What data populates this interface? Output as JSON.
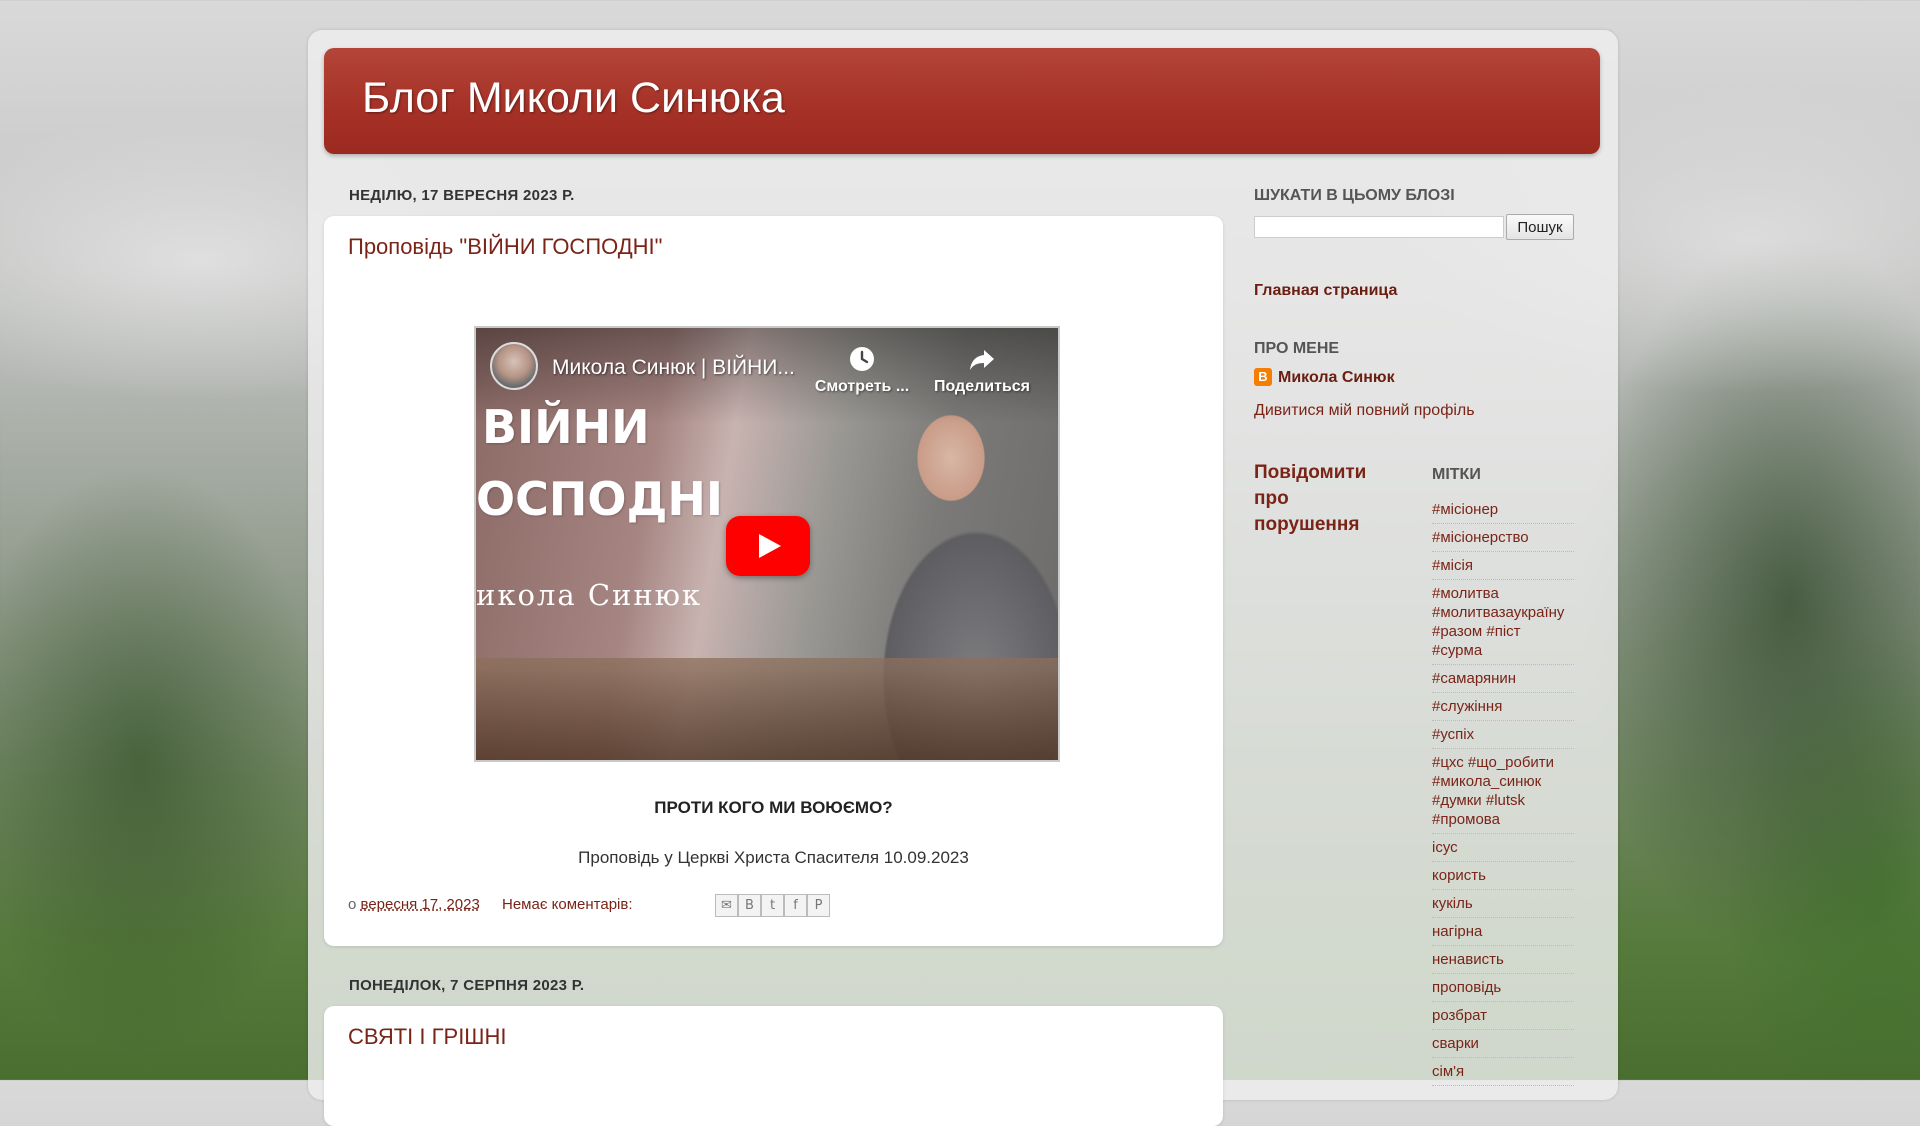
{
  "blog": {
    "title": "Блог Миколи Синюка"
  },
  "posts": [
    {
      "date_header": "НЕДІЛЮ, 17 ВЕРЕСНЯ 2023 Р.",
      "title": "Проповідь \"ВІЙНИ ГОСПОДНІ\"",
      "video": {
        "title": "Микола Синюк | ВІЙНИ...",
        "watch_later": "Смотреть ...",
        "share": "Поделиться",
        "overlay_line1": "ВІЙНИ",
        "overlay_line2": "ОСПОДНІ",
        "overlay_name": "икола Синюк"
      },
      "subtitle": "ПРОТИ КОГО МИ ВОЮЄМО?",
      "body": "Проповідь у Церкві Христа Спасителя 10.09.2023",
      "footer": {
        "prefix": "о",
        "date_link": "вересня 17, 2023",
        "comments": "Немає коментарів:"
      },
      "share_icons": [
        "email-icon",
        "blogger-icon",
        "twitter-icon",
        "facebook-icon",
        "pinterest-icon"
      ]
    },
    {
      "date_header": "ПОНЕДІЛОК, 7 СЕРПНЯ 2023 Р.",
      "title": "СВЯТІ І ГРІШНІ"
    }
  ],
  "sidebar": {
    "search": {
      "title": "ШУКАТИ В ЦЬОМУ БЛОЗІ",
      "button": "Пошук",
      "value": ""
    },
    "home_link": "Главная страница",
    "about": {
      "title": "ПРО МЕНЕ",
      "name": "Микола Синюк",
      "profile_link": "Дивитися мій повний профіль"
    },
    "report": "Повідомити про порушення",
    "labels": {
      "title": "МІТКИ",
      "items": [
        "#місіонер",
        "#місіонерство",
        "#місія",
        "#молитва #молитвазаукраїну #разом #піст #сурма",
        "#самарянин",
        "#служіння",
        "#успіх",
        "#цхс #що_робити #микола_синюк #думки #lutsk #промова",
        "ісус",
        "користь",
        "кукіль",
        "нагірна",
        "ненависть",
        "проповідь",
        "розбрат",
        "сварки",
        "сім'я"
      ]
    }
  },
  "colors": {
    "header_red": "#a53026",
    "link": "#7a2418",
    "play_red": "#ff0000"
  }
}
